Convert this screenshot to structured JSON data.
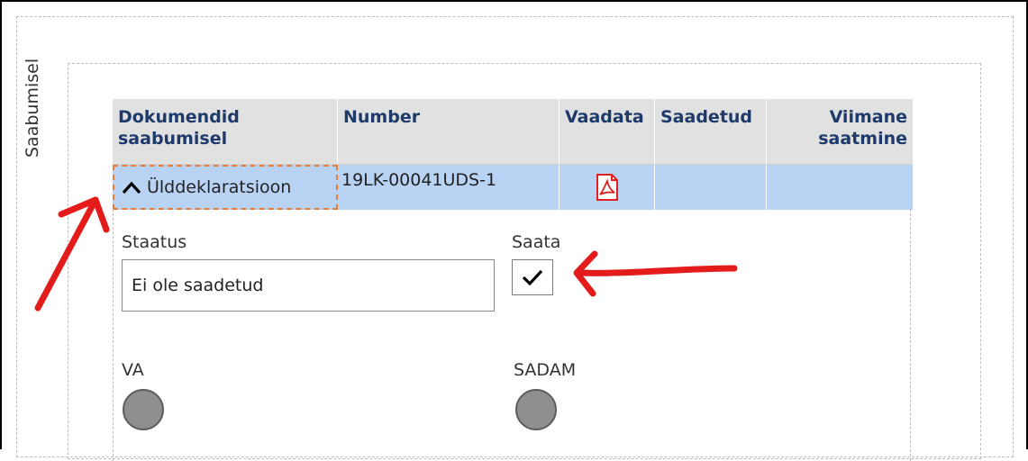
{
  "group": {
    "label": "Saabumisel"
  },
  "grid": {
    "columns": [
      "Dokumendid saabumisel",
      "Number",
      "Vaadata",
      "Saadetud",
      "Viimane saatmine"
    ],
    "rows": [
      {
        "document": "Ülddeklaratsioon",
        "number": "19LK-00041UDS-1",
        "view_icon": "pdf-icon",
        "sent": "",
        "last_sent": ""
      }
    ]
  },
  "detail": {
    "status_label": "Staatus",
    "status_value": "Ei ole saadetud",
    "send_label": "Saata",
    "send_checked": true,
    "va_label": "VA",
    "port_label": "SADAM"
  },
  "colors": {
    "header_bg": "#e1e1e1",
    "header_text": "#1d3a6b",
    "selected_row_bg": "#b9d3f4",
    "focus_dash": "#e87a3a",
    "pdf_red": "#e02020",
    "annotation_red": "#e31b1b",
    "indicator_gray": "#8f8f8f"
  }
}
